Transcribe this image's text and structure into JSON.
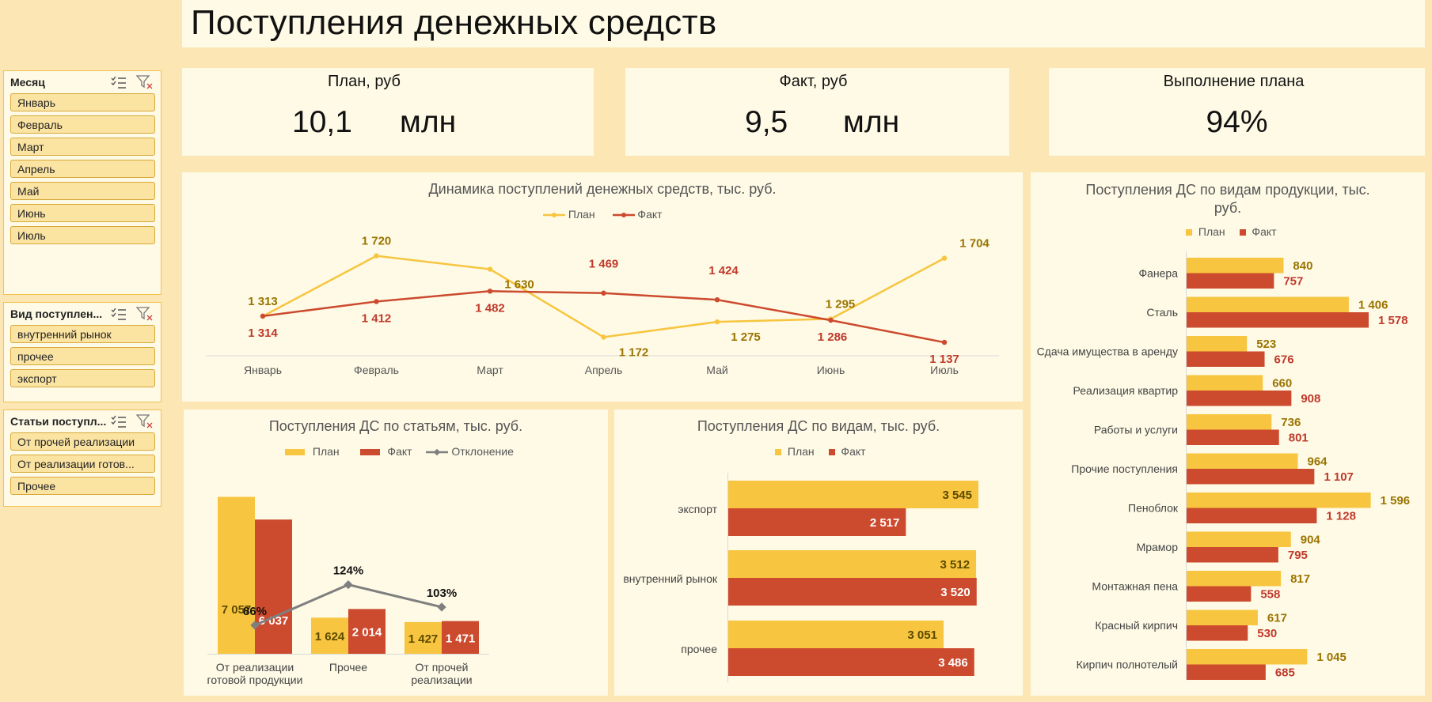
{
  "title": "Поступления денежных средств",
  "slicers": [
    {
      "title": "Месяц",
      "items": [
        "Январь",
        "Февраль",
        "Март",
        "Апрель",
        "Май",
        "Июнь",
        "Июль"
      ]
    },
    {
      "title": "Вид поступлен...",
      "items": [
        "внутренний рынок",
        "прочее",
        "экспорт"
      ]
    },
    {
      "title": "Статьи поступл...",
      "items": [
        "От прочей реализации",
        "От реализации готов...",
        "Прочее"
      ]
    }
  ],
  "icons": {
    "multiselect": "multiselect-icon",
    "clear_filter": "clear-filter-icon"
  },
  "kpis": [
    {
      "label": "План, руб",
      "value": "10,1",
      "unit": "млн"
    },
    {
      "label": "Факт, руб",
      "value": "9,5",
      "unit": "млн"
    },
    {
      "label": "Выполнение плана",
      "value": "94%"
    }
  ],
  "colors": {
    "plan": "#f7c53f",
    "fact": "#cc4a2e",
    "deviation": "#7f7f7f",
    "plan_label": "#9a7400",
    "fact_label": "#c0392b"
  },
  "chart_data": [
    {
      "type": "line",
      "title": "Динамика поступлений денежных средств, тыс. руб.",
      "categories": [
        "Январь",
        "Февраль",
        "Март",
        "Апрель",
        "Май",
        "Июнь",
        "Июль"
      ],
      "series": [
        {
          "name": "План",
          "values": [
            1313,
            1720,
            1630,
            1172,
            1275,
            1295,
            1704
          ],
          "labels": [
            "1 313",
            "1 720",
            "1 630",
            "1 172",
            "1 275",
            "1 295",
            "1 704"
          ]
        },
        {
          "name": "Факт",
          "values": [
            1314,
            1412,
            1482,
            1469,
            1424,
            1286,
            1137
          ],
          "labels": [
            "1 314",
            "1 412",
            "1 482",
            "1 469",
            "1 424",
            "1 286",
            "1 137"
          ]
        }
      ],
      "legend": "top"
    },
    {
      "type": "bar",
      "title": "Поступления ДС по статьям, тыс. руб.",
      "categories": [
        "От реализации готовой продукции",
        "Прочее",
        "От прочей реализации"
      ],
      "category_lines": [
        [
          "От реализации",
          "готовой продукции"
        ],
        [
          "Прочее"
        ],
        [
          "От прочей",
          "реализации"
        ]
      ],
      "series": [
        {
          "name": "План",
          "values": [
            7057,
            1624,
            1427
          ],
          "labels": [
            "7 057",
            "1 624",
            "1 427"
          ]
        },
        {
          "name": "Факт",
          "values": [
            6037,
            2014,
            1471
          ],
          "labels": [
            "6 037",
            "2 014",
            "1 471"
          ]
        },
        {
          "name": "Отклонение",
          "values": [
            86,
            124,
            103
          ],
          "labels": [
            "86%",
            "124%",
            "103%"
          ]
        }
      ],
      "legend": "top"
    },
    {
      "type": "bar",
      "title": "Поступления ДС по видам, тыс. руб.",
      "orientation": "horizontal",
      "categories": [
        "экспорт",
        "внутренний рынок",
        "прочее"
      ],
      "series": [
        {
          "name": "План",
          "values": [
            3545,
            3512,
            3051
          ],
          "labels": [
            "3 545",
            "3 512",
            "3 051"
          ]
        },
        {
          "name": "Факт",
          "values": [
            2517,
            3520,
            3486
          ],
          "labels": [
            "2 517",
            "3 520",
            "3 486"
          ]
        }
      ],
      "legend": "top"
    },
    {
      "type": "bar",
      "title": "Поступления ДС по видам продукции, тыс. руб.",
      "title_lines": [
        "Поступления ДС по видам продукции, тыс.",
        "руб."
      ],
      "orientation": "horizontal",
      "categories": [
        "Фанера",
        "Сталь",
        "Сдача имущества в аренду",
        "Реализация квартир",
        "Работы и услуги",
        "Прочие поступления",
        "Пеноблок",
        "Мрамор",
        "Монтажная пена",
        "Красный кирпич",
        "Кирпич полнотелый"
      ],
      "series": [
        {
          "name": "План",
          "values": [
            840,
            1406,
            523,
            660,
            736,
            964,
            1596,
            904,
            817,
            617,
            1045
          ],
          "labels": [
            "840",
            "1 406",
            "523",
            "660",
            "736",
            "964",
            "1 596",
            "904",
            "817",
            "617",
            "1 045"
          ]
        },
        {
          "name": "Факт",
          "values": [
            757,
            1578,
            676,
            908,
            801,
            1107,
            1128,
            795,
            558,
            530,
            685
          ],
          "labels": [
            "757",
            "1 578",
            "676",
            "908",
            "801",
            "1 107",
            "1 128",
            "795",
            "558",
            "530",
            "685"
          ]
        }
      ],
      "legend": "top"
    }
  ]
}
